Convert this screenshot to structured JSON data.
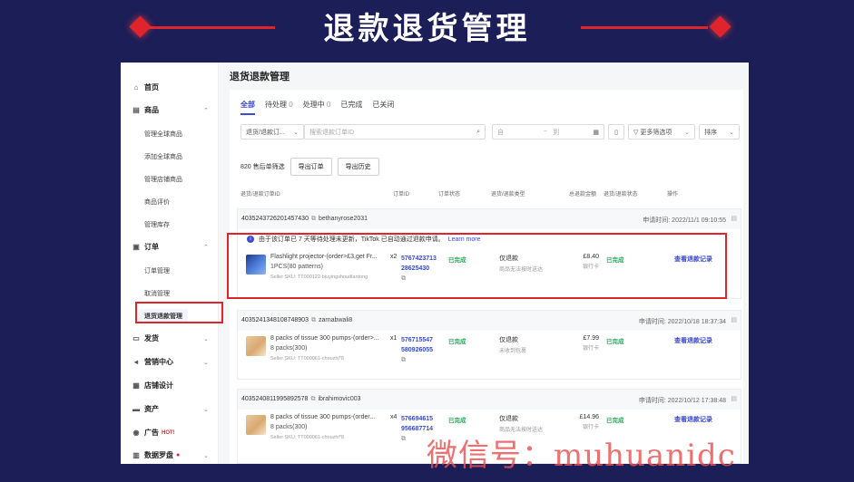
{
  "banner": {
    "title": "退款退货管理"
  },
  "colors": {
    "background": "#1b1e57",
    "accent": "#e0242c",
    "link": "#3c4bd0",
    "success": "#2aa85c"
  },
  "sidebar": {
    "items": [
      {
        "label": "首页",
        "icon": "home-icon"
      },
      {
        "label": "商品",
        "icon": "box-icon",
        "subitems": [
          "管理全球商品",
          "添加全球商品",
          "管理店铺商品",
          "商品评价",
          "管理库存"
        ]
      },
      {
        "label": "订单",
        "icon": "order-icon",
        "subitems": [
          "订单管理",
          "取消管理",
          "退货退款管理"
        ]
      },
      {
        "label": "发货",
        "icon": "truck-icon"
      },
      {
        "label": "营销中心",
        "icon": "megaphone-icon"
      },
      {
        "label": "店铺设计",
        "icon": "store-icon"
      },
      {
        "label": "资产",
        "icon": "wallet-icon"
      },
      {
        "label": "广告",
        "icon": "ad-icon",
        "badge": "HOT!"
      },
      {
        "label": "数据罗盘",
        "icon": "chart-icon"
      }
    ]
  },
  "main": {
    "title": "退货退款管理",
    "tabs": [
      {
        "label": "全部",
        "count": ""
      },
      {
        "label": "待处理",
        "count": "0"
      },
      {
        "label": "处理中",
        "count": "0"
      },
      {
        "label": "已完成",
        "count": ""
      },
      {
        "label": "已关闭",
        "count": ""
      }
    ],
    "filters": {
      "type_select": "退货/退款订...",
      "search_placeholder": "搜索退款订单ID",
      "date_from": "自",
      "date_to": "到",
      "more_filters": "更多筛选项",
      "sort": "排序"
    },
    "summary": {
      "count_text": "820 售后单筛选",
      "export_button": "导出订单",
      "history_button": "导出历史"
    },
    "columns": [
      "退货/退款订单ID",
      "订单ID",
      "订单状态",
      "退货/退款类型",
      "总退款金额",
      "退货/退款状态",
      "操作"
    ],
    "orders": [
      {
        "return_id": "4035243726201457430",
        "buyer": "bethanyrose2031",
        "date": "申请时间: 2022/11/1 09:10:55",
        "notice": "由于该订单已 7 天等待处理未更新，TikTok 已自动通过退款申请。",
        "notice_link": "Learn more",
        "product_name": "Flashlight projector-(order>£3,get Fr...",
        "qty": "x2",
        "variant": "1PCS(80 patterns)",
        "sku": "Seller SKU: TT000122-biuyingshoudiantong",
        "order_id_1": "5767423713",
        "order_id_2": "28625430",
        "order_status": "已完成",
        "refund_type": "仅退款",
        "refund_reason": "商品无法按时送达",
        "amount": "£8.40",
        "pay_method": "银行卡",
        "refund_status": "已完成",
        "action": "查看退款记录"
      },
      {
        "return_id": "4035241348108748903",
        "buyer": "zarnabwali8",
        "date": "申请时间: 2022/10/18 18:37:34",
        "product_name": "8 packs of tissue 300 pumps-(order>...",
        "qty": "x1",
        "variant": "8 packs(300)",
        "sku": "Seller SKU: TT000061-chouzhi*8",
        "order_id_1": "576715547",
        "order_id_2": "580926055",
        "order_status": "已完成",
        "refund_type": "仅退款",
        "refund_reason": "未收到包裹",
        "amount": "£7.99",
        "pay_method": "银行卡",
        "refund_status": "已完成",
        "action": "查看退款记录"
      },
      {
        "return_id": "4035240811995892578",
        "buyer": "ibrahimovic003",
        "date": "申请时间: 2022/10/12 17:38:48",
        "product_name": "8 packs of tissue 300 pumps-(order...",
        "qty": "x4",
        "variant": "8 packs(300)",
        "sku": "Seller SKU: TT000061-chouzhi*8",
        "order_id_1": "576694615",
        "order_id_2": "956687714",
        "order_status": "已完成",
        "refund_type": "仅退款",
        "refund_reason": "商品无法按时送达",
        "amount": "£14.96",
        "pay_method": "银行卡",
        "refund_status": "已完成",
        "action": "查看退款记录"
      }
    ]
  },
  "watermark": "微信号：muhuanidc"
}
